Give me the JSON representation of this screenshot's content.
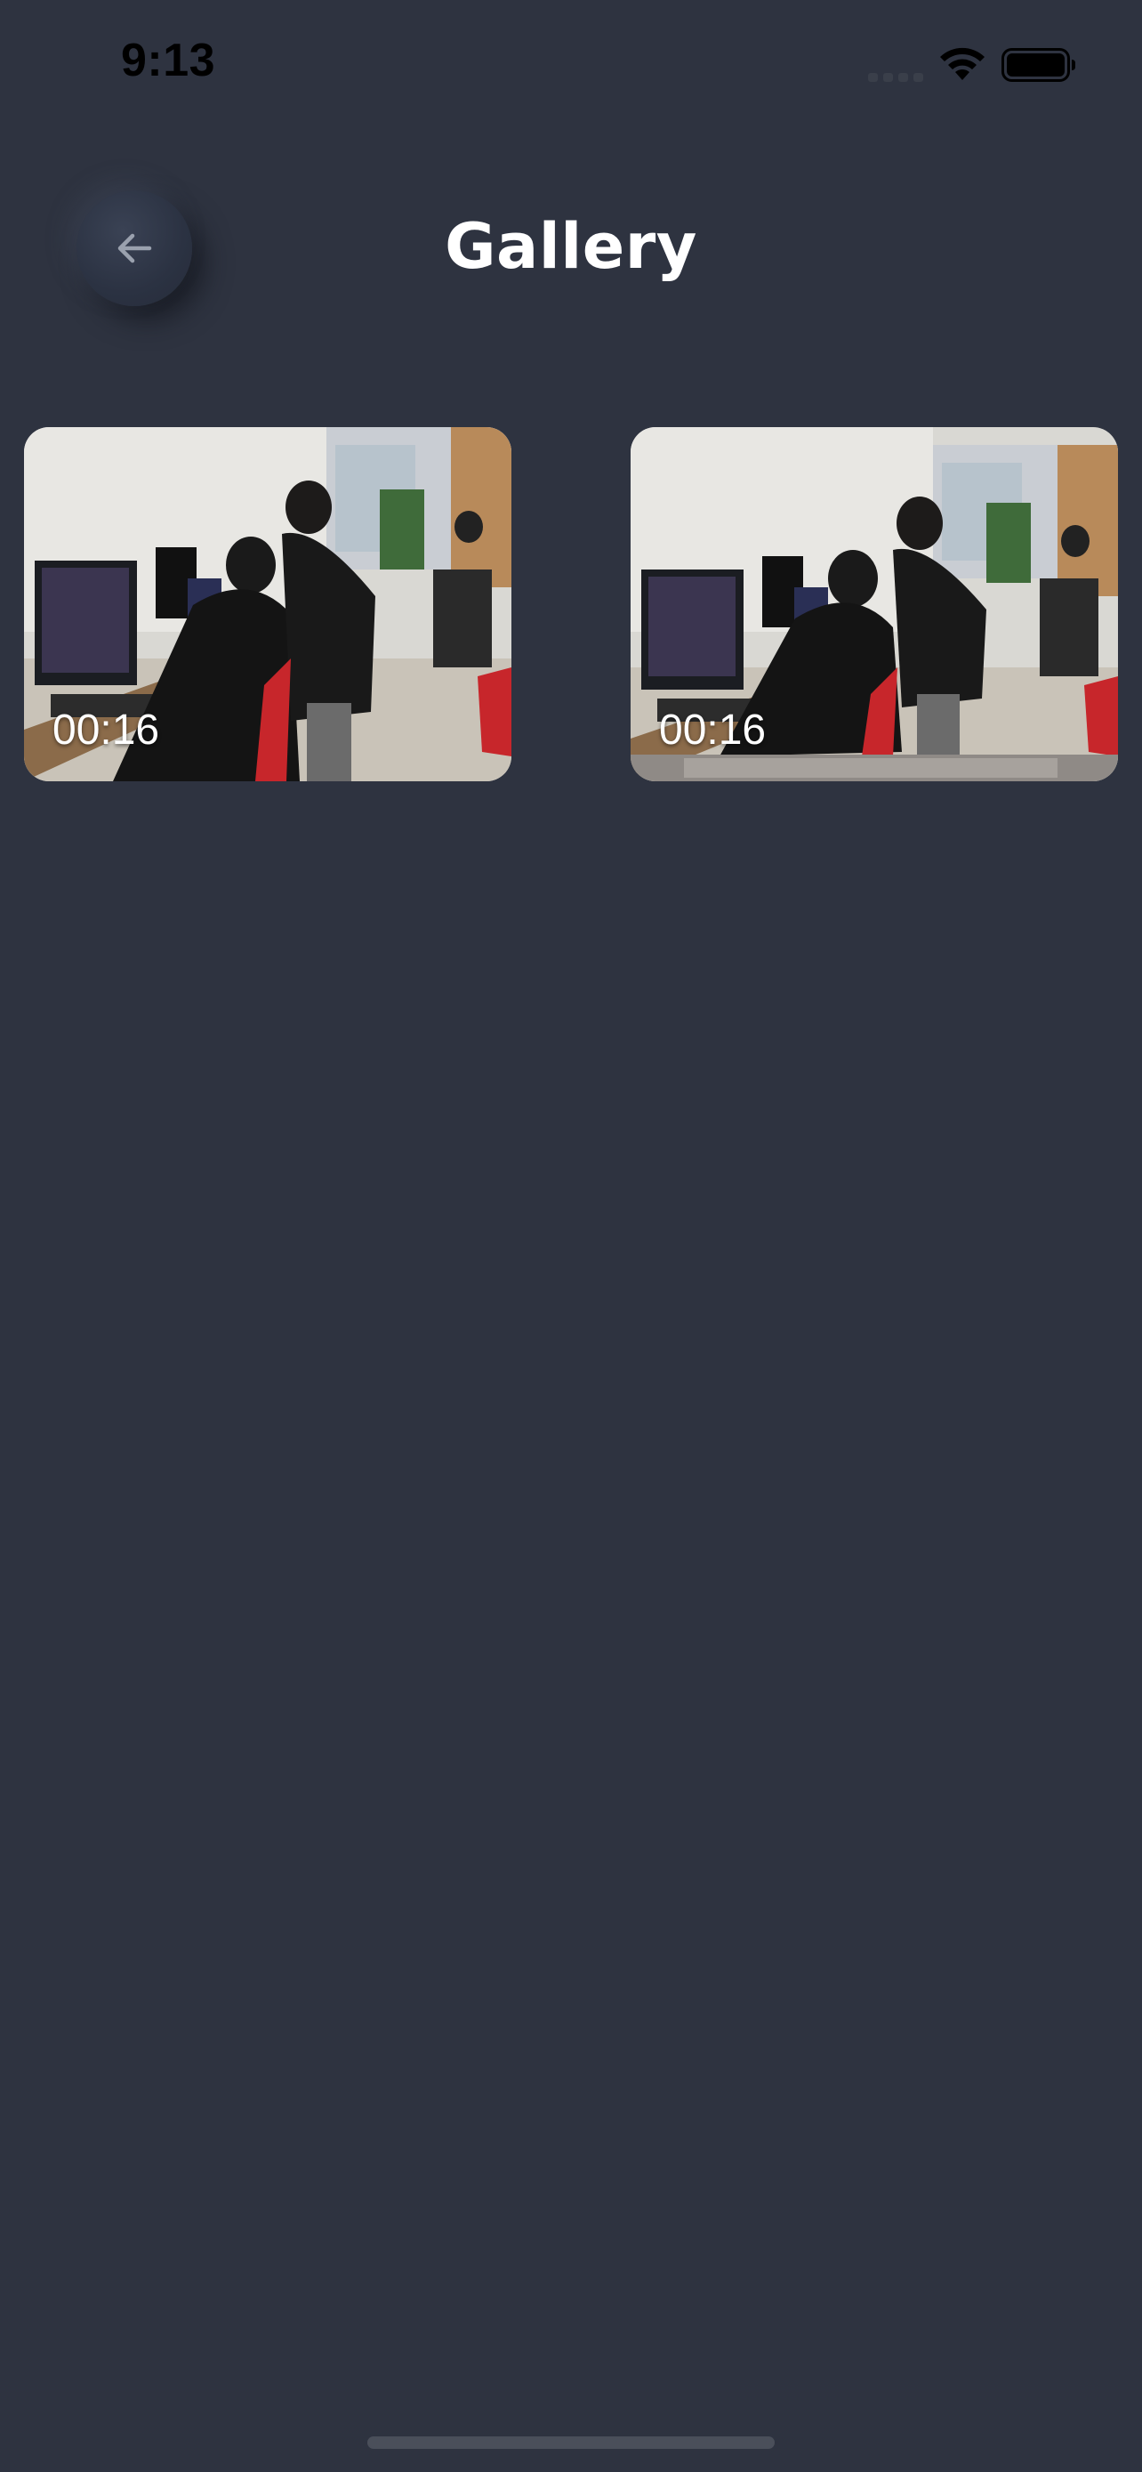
{
  "status_bar": {
    "time": "9:13"
  },
  "header": {
    "title": "Gallery",
    "back_icon": "arrow-left-icon"
  },
  "gallery": {
    "items": [
      {
        "duration": "00:16"
      },
      {
        "duration": "00:16"
      }
    ]
  },
  "colors": {
    "background": "#2e3340",
    "text": "#ffffff"
  }
}
